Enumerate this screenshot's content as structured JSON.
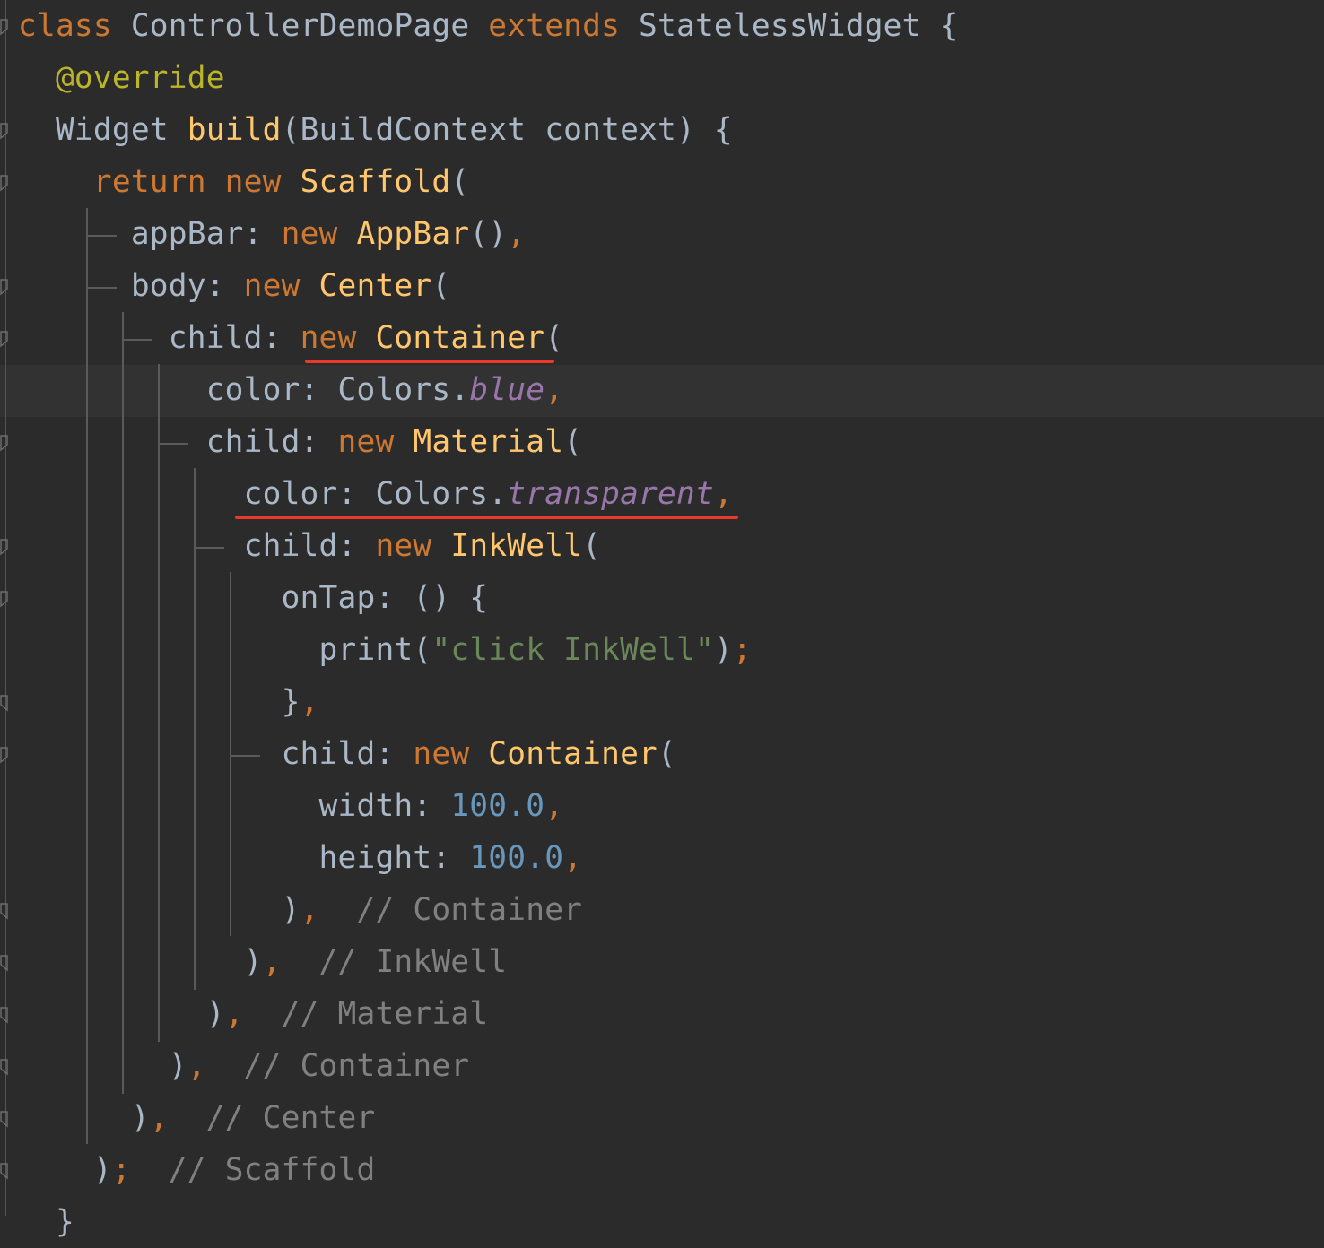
{
  "editor": {
    "lines": [
      [
        {
          "t": "class",
          "c": "kw"
        },
        {
          "t": " ControllerDemoPage ",
          "c": "plain"
        },
        {
          "t": "extends",
          "c": "kw"
        },
        {
          "t": " StatelessWidget {",
          "c": "plain"
        }
      ],
      [
        {
          "t": "  ",
          "c": "plain"
        },
        {
          "t": "@override",
          "c": "ann"
        }
      ],
      [
        {
          "t": "  Widget ",
          "c": "plain"
        },
        {
          "t": "build",
          "c": "fn"
        },
        {
          "t": "(BuildContext context) {",
          "c": "plain"
        }
      ],
      [
        {
          "t": "    ",
          "c": "plain"
        },
        {
          "t": "return new ",
          "c": "kw"
        },
        {
          "t": "Scaffold",
          "c": "fn"
        },
        {
          "t": "(",
          "c": "plain"
        }
      ],
      [
        {
          "t": "      appBar: ",
          "c": "plain"
        },
        {
          "t": "new ",
          "c": "kw"
        },
        {
          "t": "AppBar",
          "c": "fn"
        },
        {
          "t": "()",
          "c": "plain"
        },
        {
          "t": ",",
          "c": "kw"
        }
      ],
      [
        {
          "t": "      body: ",
          "c": "plain"
        },
        {
          "t": "new ",
          "c": "kw"
        },
        {
          "t": "Center",
          "c": "fn"
        },
        {
          "t": "(",
          "c": "plain"
        }
      ],
      [
        {
          "t": "        child: ",
          "c": "plain"
        },
        {
          "t": "new ",
          "c": "kw"
        },
        {
          "t": "Container",
          "c": "fn"
        },
        {
          "t": "(",
          "c": "plain"
        }
      ],
      [
        {
          "t": "          color: Colors.",
          "c": "plain"
        },
        {
          "t": "blue",
          "c": "field"
        },
        {
          "t": ",",
          "c": "kw"
        }
      ],
      [
        {
          "t": "          child: ",
          "c": "plain"
        },
        {
          "t": "new ",
          "c": "kw"
        },
        {
          "t": "Material",
          "c": "fn"
        },
        {
          "t": "(",
          "c": "plain"
        }
      ],
      [
        {
          "t": "            color: Colors.",
          "c": "plain"
        },
        {
          "t": "transparent",
          "c": "field"
        },
        {
          "t": ",",
          "c": "kw"
        }
      ],
      [
        {
          "t": "            child: ",
          "c": "plain"
        },
        {
          "t": "new ",
          "c": "kw"
        },
        {
          "t": "InkWell",
          "c": "fn"
        },
        {
          "t": "(",
          "c": "plain"
        }
      ],
      [
        {
          "t": "              onTap: () {",
          "c": "plain"
        }
      ],
      [
        {
          "t": "                print(",
          "c": "plain"
        },
        {
          "t": "\"click InkWell\"",
          "c": "str"
        },
        {
          "t": ")",
          "c": "plain"
        },
        {
          "t": ";",
          "c": "kw"
        }
      ],
      [
        {
          "t": "              }",
          "c": "plain"
        },
        {
          "t": ",",
          "c": "kw"
        }
      ],
      [
        {
          "t": "              child: ",
          "c": "plain"
        },
        {
          "t": "new ",
          "c": "kw"
        },
        {
          "t": "Container",
          "c": "fn"
        },
        {
          "t": "(",
          "c": "plain"
        }
      ],
      [
        {
          "t": "                width: ",
          "c": "plain"
        },
        {
          "t": "100.0",
          "c": "num"
        },
        {
          "t": ",",
          "c": "kw"
        }
      ],
      [
        {
          "t": "                height: ",
          "c": "plain"
        },
        {
          "t": "100.0",
          "c": "num"
        },
        {
          "t": ",",
          "c": "kw"
        }
      ],
      [
        {
          "t": "              )",
          "c": "plain"
        },
        {
          "t": ",",
          "c": "kw"
        },
        {
          "t": "  // Container",
          "c": "cm"
        }
      ],
      [
        {
          "t": "            )",
          "c": "plain"
        },
        {
          "t": ",",
          "c": "kw"
        },
        {
          "t": "  // InkWell",
          "c": "cm"
        }
      ],
      [
        {
          "t": "          )",
          "c": "plain"
        },
        {
          "t": ",",
          "c": "kw"
        },
        {
          "t": "  // Material",
          "c": "cm"
        }
      ],
      [
        {
          "t": "        )",
          "c": "plain"
        },
        {
          "t": ",",
          "c": "kw"
        },
        {
          "t": "  // Container",
          "c": "cm"
        }
      ],
      [
        {
          "t": "      )",
          "c": "plain"
        },
        {
          "t": ",",
          "c": "kw"
        },
        {
          "t": "  // Center",
          "c": "cm"
        }
      ],
      [
        {
          "t": "    )",
          "c": "plain"
        },
        {
          "t": ";",
          "c": "kw"
        },
        {
          "t": "  // Scaffold",
          "c": "cm"
        }
      ],
      [
        {
          "t": "  }",
          "c": "plain"
        }
      ]
    ]
  },
  "colors": {
    "background": "#2b2b2b",
    "current_line": "#323232",
    "keyword": "#cc7832",
    "annotation": "#bbb529",
    "function": "#ffc66d",
    "string": "#6a8759",
    "number": "#6897bb",
    "comment": "#808080",
    "field": "#9876aa",
    "text": "#a9b7c6",
    "highlight_underline": "#e8392b"
  },
  "highlights": [
    "new Container(",
    "color: Colors.transparent,"
  ]
}
